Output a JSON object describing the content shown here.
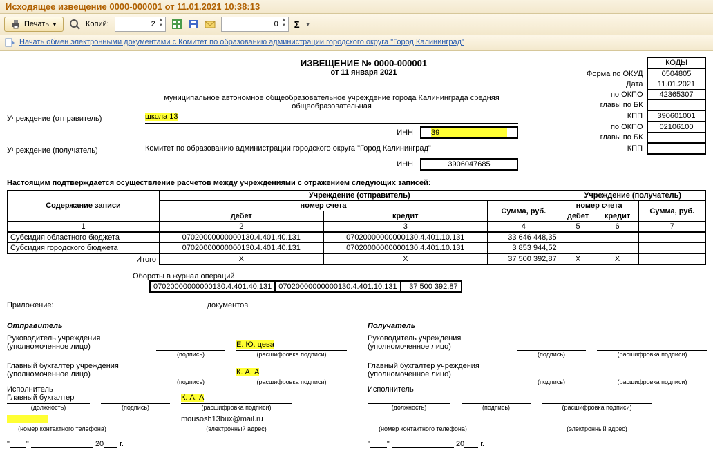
{
  "window_title": "Исходящее извещение 0000-000001 от 11.01.2021 10:38:13",
  "toolbar": {
    "print": "Печать",
    "copies_label": "Копий:",
    "copies_value": "2",
    "second_input": "0",
    "sigma": "Σ"
  },
  "linkbar": {
    "text": "Начать обмен электронными документами с Комитет по образованию администрации городского округа \"Город Калининград\""
  },
  "header": {
    "line1": "ИЗВЕЩЕНИЕ № 0000-000001",
    "line2": "от 11 января 2021",
    "desc": "муниципальное  автономное общеобразовательное учреждение  города Калининграда средняя общеобразовательная",
    "desc2_hl": "школа  13"
  },
  "codes": {
    "header": "КОДЫ",
    "okud_lbl": "Форма по ОКУД",
    "okud": "0504805",
    "date_lbl": "Дата",
    "date": "11.01.2021",
    "okpo_lbl": "по ОКПО",
    "okpo": "42365307",
    "bk1_lbl": "главы по БК",
    "kpp_lbl": "КПП",
    "kpp": "390601001",
    "okpo2_lbl": "по ОКПО",
    "okpo2": "02106100",
    "bk2_lbl": "главы по БК",
    "kpp2_lbl": "КПП"
  },
  "sender_lbl": "Учреждение (отправитель)",
  "receiver_lbl": "Учреждение (получатель)",
  "receiver_val": "Комитет по образованию администрации городского округа \"Город Калининград\"",
  "inn_lbl": "ИНН",
  "inn1_hl": "39",
  "inn2": "3906047685",
  "statement": "Настоящим подтверждается осуществление расчетов между учреждениями с отражением следующих записей:",
  "table": {
    "h_content": "Содержание записи",
    "h_sender": "Учреждение (отправитель)",
    "h_receiver": "Учреждение (получатель)",
    "h_account": "номер счета",
    "h_sum": "Сумма, руб.",
    "h_debit": "дебет",
    "h_credit": "кредит",
    "col1": "1",
    "col2": "2",
    "col3": "3",
    "col4": "4",
    "col5": "5",
    "col6": "6",
    "col7": "7",
    "rows": [
      {
        "name": "Субсидия областного бюджета",
        "d": "07020000000000130.4.401.40.131",
        "c": "07020000000000130.4.401.10.131",
        "s": "33 646 448,35"
      },
      {
        "name": "Субсидия городского бюджета",
        "d": "07020000000000130.4.401.40.131",
        "c": "07020000000000130.4.401.10.131",
        "s": "3 853 944,52"
      }
    ],
    "total_lbl": "Итого",
    "total_x": "Х",
    "total_sum": "37 500 392,87"
  },
  "oborot": {
    "label": "Обороты в журнал операций",
    "d": "07020000000000130.4.401.40.131",
    "c": "07020000000000130.4.401.10.131",
    "s": "37 500 392,87"
  },
  "attachment": {
    "label": "Приложение:",
    "n": "",
    "docs": "документов"
  },
  "sign": {
    "sender_title": "Отправитель",
    "receiver_title": "Получатель",
    "head": "Руководитель учреждения",
    "auth": "(уполномоченное лицо)",
    "chief": "Главный бухгалтер учреждения",
    "exec": "Исполнитель",
    "chief_short": "Главный бухгалтер",
    "sig": "(подпись)",
    "dec": "(расшифровка подписи)",
    "pos": "(должность)",
    "tel": "(номер контактного телефона)",
    "email_lbl": "(электронный адрес)",
    "name1": "Е. Ю.            цева",
    "name2": "К. А. А",
    "name3": "К. А. А",
    "email": "mousosh13bux@mail.ru"
  },
  "dateline": {
    "y_suffix": " г.",
    "y_prefix": "20"
  }
}
